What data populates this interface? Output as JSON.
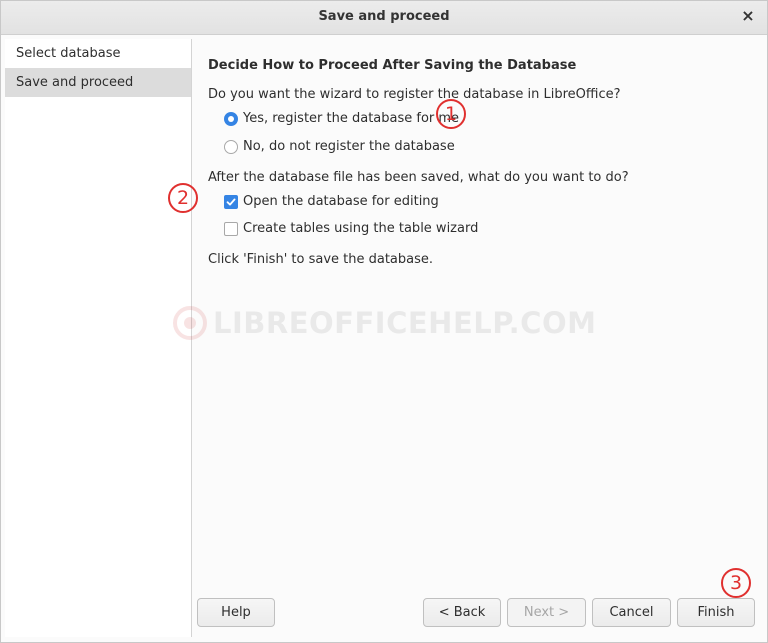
{
  "window": {
    "title": "Save and proceed",
    "close_glyph": "×"
  },
  "sidebar": {
    "steps": [
      {
        "label": "Select database",
        "active": false
      },
      {
        "label": "Save and proceed",
        "active": true
      }
    ]
  },
  "main": {
    "heading": "Decide How to Proceed After Saving the Database",
    "register_question": "Do you want the wizard to register the database in LibreOffice?",
    "register_options": [
      {
        "label": "Yes, register the database for me",
        "checked": true
      },
      {
        "label": "No, do not register the database",
        "checked": false
      }
    ],
    "after_save_question": "After the database file has been saved, what do you want to do?",
    "after_save_options": [
      {
        "label": "Open the database for editing",
        "checked": true
      },
      {
        "label": "Create tables using the table wizard",
        "checked": false
      }
    ],
    "finish_hint": "Click 'Finish' to save the database."
  },
  "watermark": {
    "text": "LIBREOFFICEHELP.COM"
  },
  "buttons": {
    "help": "Help",
    "back": "< Back",
    "next": "Next >",
    "cancel": "Cancel",
    "finish": "Finish"
  },
  "annotations": [
    "1",
    "2",
    "3"
  ],
  "colors": {
    "accent": "#3584e4",
    "annotation": "#e0302f",
    "sidebar_active": "#dcdcdc"
  }
}
